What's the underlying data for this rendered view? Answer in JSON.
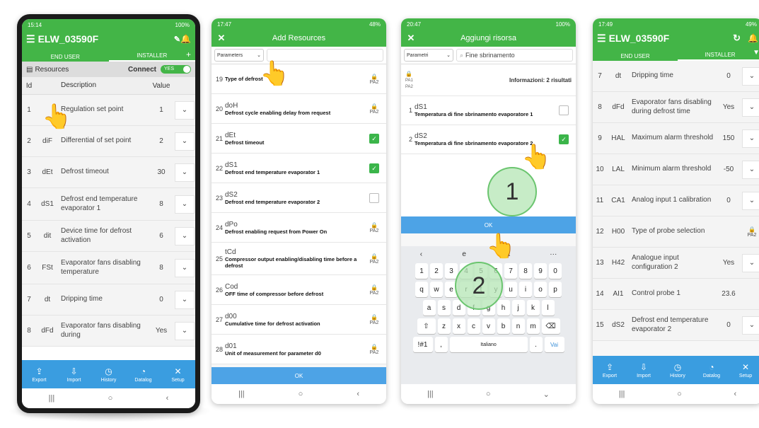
{
  "phone1": {
    "status_time": "15:14",
    "status_right": "100%",
    "device_name": "ELW_03590F",
    "tabs": [
      "END USER",
      "INSTALLER"
    ],
    "resources_label": "Resources",
    "connect_label": "Connect",
    "toggle_label": "YES",
    "columns": [
      "Id",
      "Description",
      "Value"
    ],
    "rows": [
      {
        "id": "1",
        "code": "",
        "desc": "Regulation set point",
        "value": "1"
      },
      {
        "id": "2",
        "code": "diF",
        "desc": "Differential of set point",
        "value": "2"
      },
      {
        "id": "3",
        "code": "dEt",
        "desc": "Defrost timeout",
        "value": "30"
      },
      {
        "id": "4",
        "code": "dS1",
        "desc": "Defrost end temperature evaporator 1",
        "value": "8"
      },
      {
        "id": "5",
        "code": "dit",
        "desc": "Device time for defrost activation",
        "value": "6"
      },
      {
        "id": "6",
        "code": "FSt",
        "desc": "Evaporator fans disabling temperature",
        "value": "8"
      },
      {
        "id": "7",
        "code": "dt",
        "desc": "Dripping time",
        "value": "0"
      },
      {
        "id": "8",
        "code": "dFd",
        "desc": "Evaporator fans disabling during",
        "value": "Yes"
      }
    ]
  },
  "bottom_nav": [
    "Export",
    "Import",
    "History",
    "Datalog",
    "Setup"
  ],
  "phone2": {
    "status_time": "17:47",
    "status_right": "48%",
    "title": "Add Resources",
    "filter": "Parameters",
    "items": [
      {
        "num": "19",
        "code": "",
        "desc": "Type of defrost",
        "right": "PA2",
        "state": "lock"
      },
      {
        "num": "20",
        "code": "doH",
        "desc": "Defrost cycle enabling delay from request",
        "right": "PA2",
        "state": "lock"
      },
      {
        "num": "21",
        "code": "dEt",
        "desc": "Defrost timeout",
        "right": "",
        "state": "on"
      },
      {
        "num": "22",
        "code": "dS1",
        "desc": "Defrost end temperature evaporator 1",
        "right": "",
        "state": "on"
      },
      {
        "num": "23",
        "code": "dS2",
        "desc": "Defrost end temperature evaporator 2",
        "right": "",
        "state": "off"
      },
      {
        "num": "24",
        "code": "dPo",
        "desc": "Defrost enabling request from Power On",
        "right": "PA2",
        "state": "lock"
      },
      {
        "num": "25",
        "code": "tCd",
        "desc": "Compressor output enabling/disabling time before a defrost",
        "right": "PA2",
        "state": "lock"
      },
      {
        "num": "26",
        "code": "Cod",
        "desc": "OFF time of compressor before defrost",
        "right": "PA2",
        "state": "lock"
      },
      {
        "num": "27",
        "code": "d00",
        "desc": "Cumulative time for defrost activation",
        "right": "PA2",
        "state": "lock"
      },
      {
        "num": "28",
        "code": "d01",
        "desc": "Unit of measurement for parameter d0",
        "right": "PA2",
        "state": "lock"
      }
    ],
    "ok": "OK"
  },
  "phone3": {
    "status_time": "20:47",
    "status_right": "100%",
    "title": "Aggiungi risorsa",
    "filter": "Parametri",
    "search": "Fine sbrinamento",
    "info": "Informazioni: 2 risultati",
    "pa1": "PA1",
    "pa2": "PA2",
    "items": [
      {
        "num": "1",
        "code": "dS1",
        "desc": "Temperatura di fine sbrinamento evaporatore 1",
        "state": "off"
      },
      {
        "num": "2",
        "code": "dS2",
        "desc": "Temperatura di fine sbrinamento evaporatore 2",
        "state": "on"
      }
    ],
    "ok": "OK",
    "kb_row0": [
      "e",
      "a"
    ],
    "kb_row1": [
      "1",
      "2",
      "3",
      "4",
      "5",
      "6",
      "7",
      "8",
      "9",
      "0"
    ],
    "kb_row2": [
      "q",
      "w",
      "e",
      "r",
      "t",
      "y",
      "u",
      "i",
      "o",
      "p"
    ],
    "kb_row3": [
      "a",
      "s",
      "d",
      "f",
      "g",
      "h",
      "j",
      "k",
      "l"
    ],
    "kb_row4": [
      "z",
      "x",
      "c",
      "v",
      "b",
      "n",
      "m"
    ],
    "kb_sym": "!#1",
    "kb_space": "Italiano",
    "kb_go": "Vai",
    "badge1": "1",
    "badge2": "2"
  },
  "phone4": {
    "status_time": "17:49",
    "status_right": "49%",
    "device_name": "ELW_03590F",
    "tabs": [
      "END USER",
      "INSTALLER"
    ],
    "rows": [
      {
        "id": "7",
        "code": "dt",
        "desc": "Dripping time",
        "value": "0",
        "act": "chev"
      },
      {
        "id": "8",
        "code": "dFd",
        "desc": "Evaporator fans disabling during defrost time",
        "value": "Yes",
        "act": "chev"
      },
      {
        "id": "9",
        "code": "HAL",
        "desc": "Maximum alarm threshold",
        "value": "150",
        "act": "chev"
      },
      {
        "id": "10",
        "code": "LAL",
        "desc": "Minimum alarm threshold",
        "value": "-50",
        "act": "chev"
      },
      {
        "id": "11",
        "code": "CA1",
        "desc": "Analog input 1 calibration",
        "value": "0",
        "act": "chev"
      },
      {
        "id": "12",
        "code": "H00",
        "desc": "Type of probe selection",
        "value": "",
        "act": "PA2"
      },
      {
        "id": "13",
        "code": "H42",
        "desc": "Analogue input configuration 2",
        "value": "Yes",
        "act": "chev"
      },
      {
        "id": "14",
        "code": "AI1",
        "desc": "Control probe 1",
        "value": "23.6",
        "act": ""
      },
      {
        "id": "15",
        "code": "dS2",
        "desc": "Defrost end temperature evaporator 2",
        "value": "0",
        "act": "chev"
      }
    ]
  }
}
